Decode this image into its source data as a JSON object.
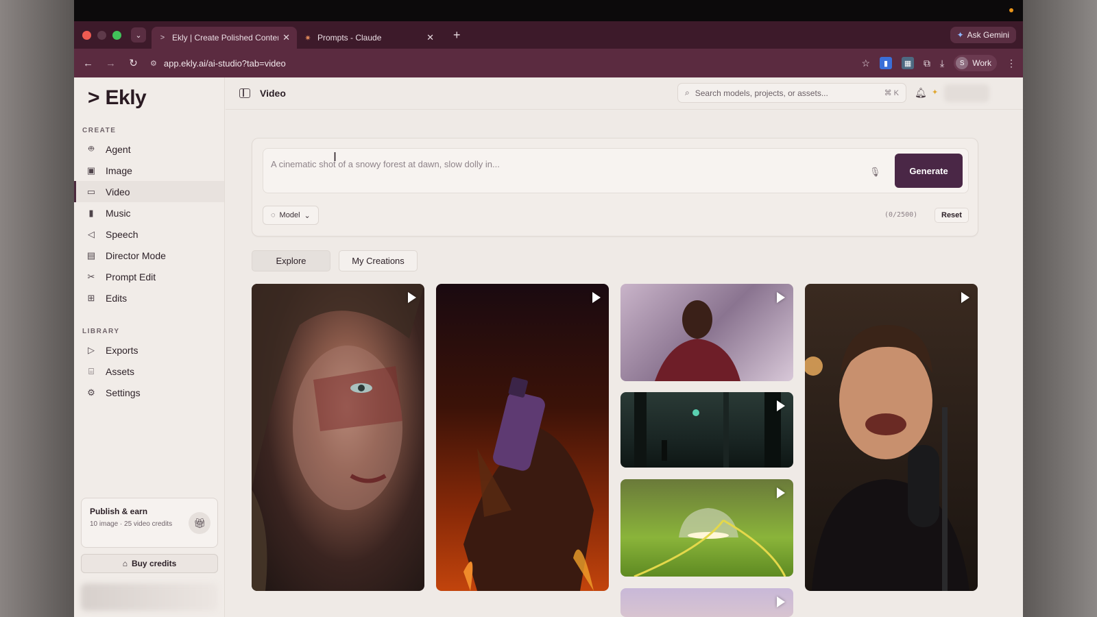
{
  "browser": {
    "tabs": [
      {
        "title": "Ekly | Create Polished Content",
        "active": true
      },
      {
        "title": "Prompts - Claude",
        "active": false
      }
    ],
    "ask_gemini": "Ask Gemini",
    "url": "app.ekly.ai/ai-studio?tab=video",
    "profile_initial": "S",
    "profile_label": "Work"
  },
  "app": {
    "logo": "Ekly",
    "page_title": "Video",
    "search_placeholder": "Search models, projects, or assets...",
    "search_shortcut": "⌘ K"
  },
  "sidebar": {
    "create_label": "CREATE",
    "create_items": [
      {
        "label": "Agent",
        "icon": "robot-icon"
      },
      {
        "label": "Image",
        "icon": "image-icon"
      },
      {
        "label": "Video",
        "icon": "video-icon",
        "active": true
      },
      {
        "label": "Music",
        "icon": "music-icon"
      },
      {
        "label": "Speech",
        "icon": "speech-icon"
      },
      {
        "label": "Director Mode",
        "icon": "clapper-icon"
      },
      {
        "label": "Prompt Edit",
        "icon": "scissors-icon"
      },
      {
        "label": "Edits",
        "icon": "edit-icon"
      }
    ],
    "library_label": "LIBRARY",
    "library_items": [
      {
        "label": "Exports",
        "icon": "play-icon"
      },
      {
        "label": "Assets",
        "icon": "folder-icon"
      },
      {
        "label": "Settings",
        "icon": "gear-icon"
      }
    ],
    "publish_title": "Publish & earn",
    "publish_sub": "10 image · 25 video credits",
    "buy_label": "Buy credits"
  },
  "prompt": {
    "placeholder": "A cinematic shot of a snowy forest at dawn, slow dolly in...",
    "generate_label": "Generate",
    "model_label": "Model",
    "counter": "(0/2500)",
    "reset_label": "Reset"
  },
  "gallery_tabs": [
    "Explore",
    "My Creations"
  ],
  "colors": {
    "brand": "#4a2746",
    "browser_chrome": "#5b2b40",
    "background": "#efeae6"
  }
}
